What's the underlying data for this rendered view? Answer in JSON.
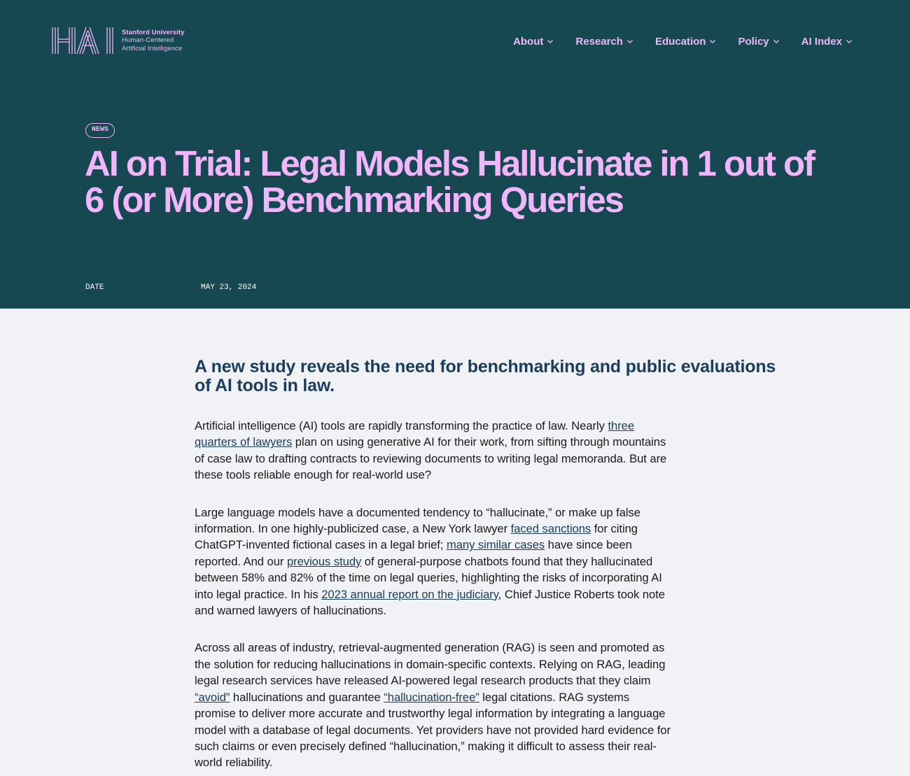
{
  "header": {
    "logo": {
      "mark": "HAI",
      "line1": "Stanford University",
      "line2": "Human-Centered",
      "line3": "Artificial Intelligence"
    },
    "nav": [
      {
        "label": "About"
      },
      {
        "label": "Research"
      },
      {
        "label": "Education"
      },
      {
        "label": "Policy"
      },
      {
        "label": "AI Index"
      }
    ]
  },
  "article": {
    "badge": "NEWS",
    "title": "AI on Trial: Legal Models Hallucinate in 1 out of 6 (or More) Benchmarking Queries",
    "date_label": "DATE",
    "date_value": "MAY 23, 2024",
    "subtitle": "A new study reveals the need for benchmarking and public evaluations of AI tools in law.",
    "p1": {
      "t1": "Artificial intelligence (AI) tools are rapidly transforming the practice of law. Nearly ",
      "link1": "three quarters of lawyers",
      "t2": " plan on using generative AI for their work, from sifting through mountains of case law to drafting contracts to reviewing documents to writing legal memoranda. But are these tools reliable enough for real-world use?"
    },
    "p2": {
      "t1": "Large language models have a documented tendency to “hallucinate,” or make up false information. In one highly-publicized case, a New York lawyer ",
      "link1": "faced sanctions",
      "t2": " for citing ChatGPT-invented fictional cases in a legal brief; ",
      "link2": "many similar cases",
      "t3": " have since been reported. And our ",
      "link3": "previous study",
      "t4": " of general-purpose chatbots found that they hallucinated between 58% and 82% of the time on legal queries, highlighting the risks of incorporating AI into legal practice. In his ",
      "link4": "2023 annual report on the judiciary",
      "t5": ", Chief Justice Roberts took note and warned lawyers of hallucinations."
    },
    "p3": {
      "t1": "Across all areas of industry, retrieval-augmented generation (RAG) is seen and promoted as the solution for reducing hallucinations in domain-specific contexts. Relying on RAG, leading legal research services have released AI-powered legal research products that they claim ",
      "link1": "“avoid”",
      "t2": " hallucinations and guarantee ",
      "link2": "“hallucination-free”",
      "t3": " legal citations. RAG systems promise to deliver more accurate and trustworthy legal information by integrating a language model with a database of legal documents. Yet providers have not provided hard evidence for such claims or even precisely defined “hallucination,” making it difficult to assess their real-world reliability."
    }
  },
  "colors": {
    "hero_bg": "#154850",
    "accent_pink": "#f0b5fa",
    "page_bg": "#f0f2f5",
    "subtitle_navy": "#1b3d5e"
  },
  "icons": [
    "hai-logo-icon",
    "chevron-down-icon"
  ]
}
